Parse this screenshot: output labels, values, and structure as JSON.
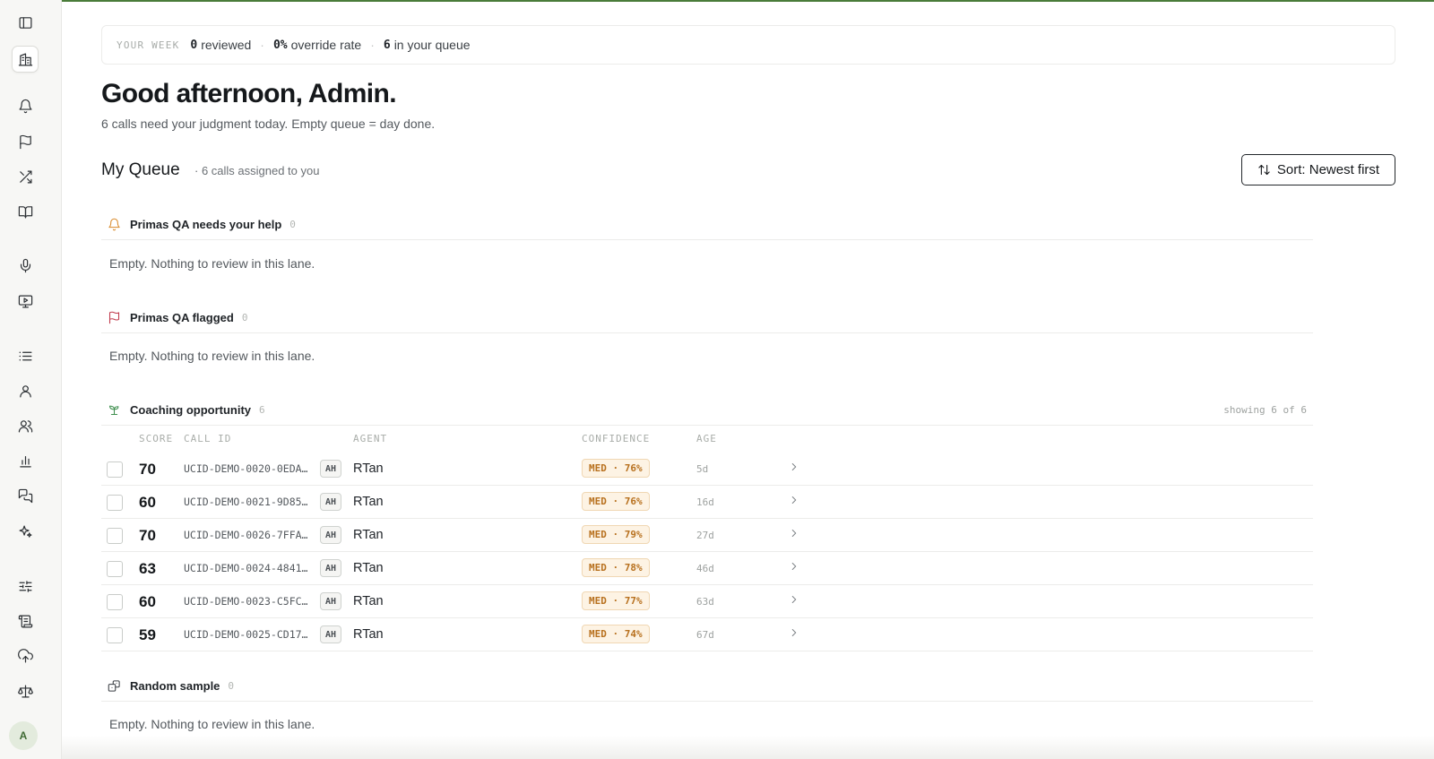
{
  "week": {
    "label": "YOUR WEEK",
    "reviewed_value": "0",
    "reviewed_text": "reviewed",
    "override_value": "0%",
    "override_text": "override rate",
    "queue_value": "6",
    "queue_text": "in your queue"
  },
  "greeting": "Good afternoon, Admin.",
  "subline": "6 calls need your judgment today. Empty queue = day done.",
  "queue": {
    "title": "My Queue",
    "count_text": "· 6 calls assigned to you",
    "sort_label": "Sort: Newest first"
  },
  "lanes": [
    {
      "title": "Primas QA needs your help",
      "count": "0",
      "empty_text": "Empty. Nothing to review in this lane.",
      "icon": "bell-icon",
      "color": "#d98a2b"
    },
    {
      "title": "Primas QA flagged",
      "count": "0",
      "empty_text": "Empty. Nothing to review in this lane.",
      "icon": "flag-icon",
      "color": "#c0394b"
    },
    {
      "title": "Coaching opportunity",
      "count": "6",
      "showing": "showing 6 of 6",
      "icon": "sprout-icon",
      "color": "#3f8f4f"
    },
    {
      "title": "Random sample",
      "count": "0",
      "empty_text": "Empty. Nothing to review in this lane.",
      "icon": "dice-icon",
      "color": "#3a3f44"
    }
  ],
  "table": {
    "headers": {
      "score": "SCORE",
      "call_id": "CALL ID",
      "agent": "AGENT",
      "confidence": "CONFIDENCE",
      "age": "AGE"
    },
    "rows": [
      {
        "score": "70",
        "call_id": "UCID-DEMO-0020-0EDA…",
        "initials": "AH",
        "agent": "RTan",
        "confidence": "MED · 76%",
        "age": "5d"
      },
      {
        "score": "60",
        "call_id": "UCID-DEMO-0021-9D85…",
        "initials": "AH",
        "agent": "RTan",
        "confidence": "MED · 76%",
        "age": "16d"
      },
      {
        "score": "70",
        "call_id": "UCID-DEMO-0026-7FFA…",
        "initials": "AH",
        "agent": "RTan",
        "confidence": "MED · 79%",
        "age": "27d"
      },
      {
        "score": "63",
        "call_id": "UCID-DEMO-0024-4841…",
        "initials": "AH",
        "agent": "RTan",
        "confidence": "MED · 78%",
        "age": "46d"
      },
      {
        "score": "60",
        "call_id": "UCID-DEMO-0023-C5FC…",
        "initials": "AH",
        "agent": "RTan",
        "confidence": "MED · 77%",
        "age": "63d"
      },
      {
        "score": "59",
        "call_id": "UCID-DEMO-0025-CD17…",
        "initials": "AH",
        "agent": "RTan",
        "confidence": "MED · 74%",
        "age": "67d"
      }
    ]
  },
  "sidebar": {
    "avatar_initial": "A",
    "icons": [
      "sidebar-toggle-icon",
      "building-icon",
      "bell-icon",
      "flag-icon",
      "shuffle-icon",
      "book-icon",
      "mic-icon",
      "monitor-play-icon",
      "list-icon",
      "user-icon",
      "users-icon",
      "bar-chart-icon",
      "chat-icon",
      "sparkles-icon",
      "sliders-icon",
      "scroll-icon",
      "upload-cloud-icon",
      "scale-icon"
    ]
  },
  "colors": {
    "accent": "#4a7c3a",
    "confidence_bg": "#fdf3e4",
    "confidence_text": "#b8711f"
  }
}
